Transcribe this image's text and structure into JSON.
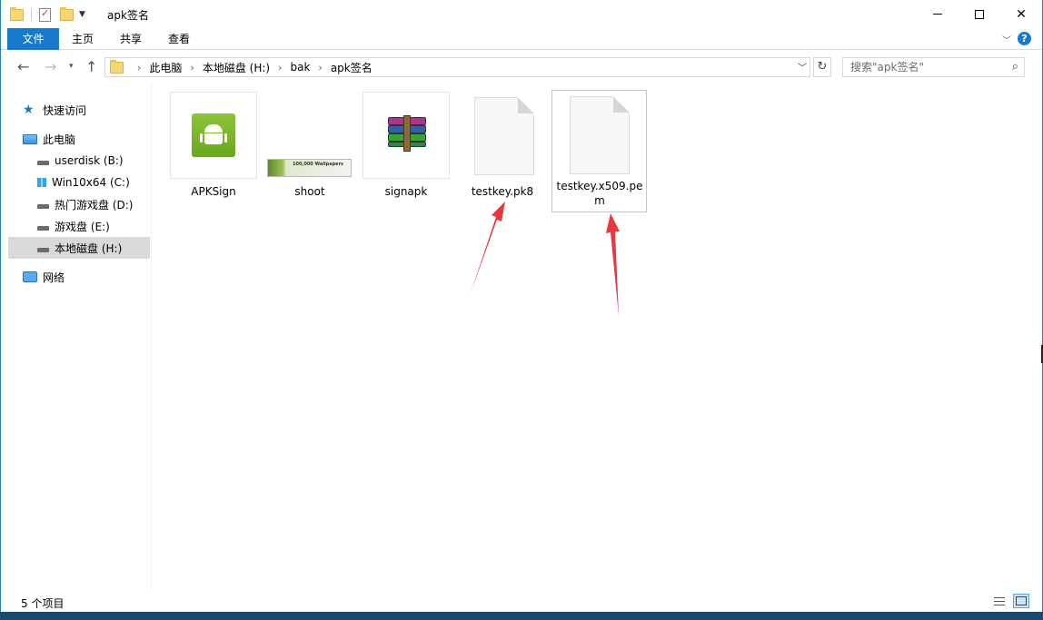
{
  "window": {
    "title": "apk签名",
    "controls": {
      "minimize": "minimize",
      "maximize": "maximize",
      "close": "✕"
    }
  },
  "ribbon": {
    "tabs": [
      {
        "label": "文件",
        "active": true
      },
      {
        "label": "主页"
      },
      {
        "label": "共享"
      },
      {
        "label": "查看"
      }
    ],
    "help": "?"
  },
  "address": {
    "breadcrumbs": [
      "此电脑",
      "本地磁盘 (H:)",
      "bak",
      "apk签名"
    ],
    "separator": "›"
  },
  "search": {
    "placeholder": "搜索\"apk签名\""
  },
  "sidebar": {
    "quick_access": "快速访问",
    "this_pc": "此电脑",
    "drives": [
      {
        "label": "userdisk (B:)",
        "icon": "drive-icon"
      },
      {
        "label": "Win10x64 (C:)",
        "icon": "windows-drive-icon"
      },
      {
        "label": "热门游戏盘 (D:)",
        "icon": "drive-icon"
      },
      {
        "label": "游戏盘 (E:)",
        "icon": "drive-icon"
      },
      {
        "label": "本地磁盘 (H:)",
        "icon": "drive-icon",
        "selected": true
      }
    ],
    "network": "网络"
  },
  "files": [
    {
      "name": "APKSign",
      "icon": "android-apk-icon"
    },
    {
      "name": "shoot",
      "icon": "image-thumbnail",
      "thumb_text": "100,000 Wallpapers"
    },
    {
      "name": "signapk",
      "icon": "winrar-archive-icon"
    },
    {
      "name": "testkey.pk8",
      "icon": "blank-document-icon"
    },
    {
      "name": "testkey.x509.pem",
      "icon": "blank-document-icon",
      "selected": true
    }
  ],
  "status": {
    "item_count": "5 个项目"
  },
  "colors": {
    "accent": "#1979ca",
    "selection_border": "#99d1ff",
    "annotation_arrow": "#e8383d"
  }
}
